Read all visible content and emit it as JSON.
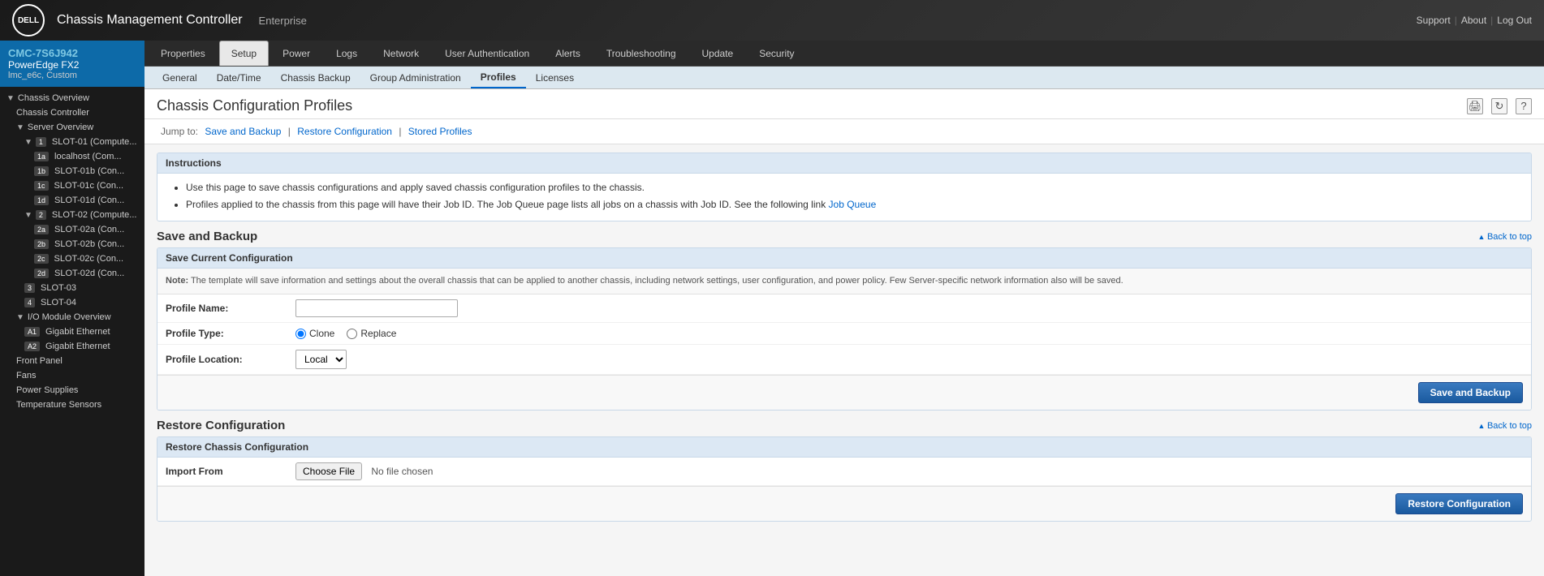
{
  "header": {
    "logo_text": "DELL",
    "title": "Chassis Management Controller",
    "edition": "Enterprise",
    "links": [
      "Support",
      "About",
      "Log Out"
    ]
  },
  "sidebar": {
    "device_id": "CMC-7S6J942",
    "device_model": "PowerEdge FX2",
    "device_info": "lmc_e6c, Custom",
    "tree": [
      {
        "id": "chassis-overview",
        "label": "Chassis Overview",
        "level": 0,
        "arrow": "▼",
        "selected": false
      },
      {
        "id": "chassis-controller",
        "label": "Chassis Controller",
        "level": 1,
        "selected": false
      },
      {
        "id": "server-overview",
        "label": "Server Overview",
        "level": 1,
        "arrow": "▼",
        "selected": false
      },
      {
        "id": "slot01",
        "label": "SLOT-01 (Compute...",
        "level": 2,
        "badge": "1",
        "arrow": "▼",
        "selected": false
      },
      {
        "id": "slot01-1a",
        "label": "localhost (Com...",
        "level": 3,
        "badge": "1a",
        "selected": false
      },
      {
        "id": "slot01-1b",
        "label": "SLOT-01b (Con...",
        "level": 3,
        "badge": "1b",
        "selected": false
      },
      {
        "id": "slot01-1c",
        "label": "SLOT-01c (Con...",
        "level": 3,
        "badge": "1c",
        "selected": false
      },
      {
        "id": "slot01-1d",
        "label": "SLOT-01d (Con...",
        "level": 3,
        "badge": "1d",
        "selected": false
      },
      {
        "id": "slot02",
        "label": "SLOT-02 (Compute...",
        "level": 2,
        "badge": "2",
        "arrow": "▼",
        "selected": false
      },
      {
        "id": "slot02-2a",
        "label": "SLOT-02a (Con...",
        "level": 3,
        "badge": "2a",
        "selected": false
      },
      {
        "id": "slot02-2b",
        "label": "SLOT-02b (Con...",
        "level": 3,
        "badge": "2b",
        "selected": false
      },
      {
        "id": "slot02-2c",
        "label": "SLOT-02c (Con...",
        "level": 3,
        "badge": "2c",
        "selected": false
      },
      {
        "id": "slot02-2d",
        "label": "SLOT-02d (Con...",
        "level": 3,
        "badge": "2d",
        "selected": false
      },
      {
        "id": "slot03",
        "label": "SLOT-03",
        "level": 2,
        "badge": "3",
        "selected": false
      },
      {
        "id": "slot04",
        "label": "SLOT-04",
        "level": 2,
        "badge": "4",
        "selected": false
      },
      {
        "id": "io-module-overview",
        "label": "I/O Module Overview",
        "level": 1,
        "arrow": "▼",
        "selected": false
      },
      {
        "id": "io-a1",
        "label": "Gigabit Ethernet",
        "level": 2,
        "badge": "A1",
        "selected": false
      },
      {
        "id": "io-a2",
        "label": "Gigabit Ethernet",
        "level": 2,
        "badge": "A2",
        "selected": false
      },
      {
        "id": "front-panel",
        "label": "Front Panel",
        "level": 1,
        "selected": false
      },
      {
        "id": "fans",
        "label": "Fans",
        "level": 1,
        "selected": false
      },
      {
        "id": "power-supplies",
        "label": "Power Supplies",
        "level": 1,
        "selected": false
      },
      {
        "id": "temperature-sensors",
        "label": "Temperature Sensors",
        "level": 1,
        "selected": false
      }
    ]
  },
  "primary_tabs": [
    {
      "id": "properties",
      "label": "Properties",
      "active": false
    },
    {
      "id": "setup",
      "label": "Setup",
      "active": true
    },
    {
      "id": "power",
      "label": "Power",
      "active": false
    },
    {
      "id": "logs",
      "label": "Logs",
      "active": false
    },
    {
      "id": "network",
      "label": "Network",
      "active": false
    },
    {
      "id": "user-auth",
      "label": "User Authentication",
      "active": false
    },
    {
      "id": "alerts",
      "label": "Alerts",
      "active": false
    },
    {
      "id": "troubleshooting",
      "label": "Troubleshooting",
      "active": false
    },
    {
      "id": "update",
      "label": "Update",
      "active": false
    },
    {
      "id": "security",
      "label": "Security",
      "active": false
    }
  ],
  "secondary_tabs": [
    {
      "id": "general",
      "label": "General",
      "active": false
    },
    {
      "id": "datetime",
      "label": "Date/Time",
      "active": false
    },
    {
      "id": "chassis-backup",
      "label": "Chassis Backup",
      "active": false
    },
    {
      "id": "group-admin",
      "label": "Group Administration",
      "active": false
    },
    {
      "id": "profiles",
      "label": "Profiles",
      "active": true
    },
    {
      "id": "licenses",
      "label": "Licenses",
      "active": false
    }
  ],
  "page": {
    "title": "Chassis Configuration Profiles",
    "jump_to_label": "Jump to:",
    "jump_links": [
      {
        "id": "save-backup-link",
        "label": "Save and Backup"
      },
      {
        "id": "restore-config-link",
        "label": "Restore Configuration"
      },
      {
        "id": "stored-profiles-link",
        "label": "Stored Profiles"
      }
    ]
  },
  "instructions": {
    "header": "Instructions",
    "bullets": [
      "Use this page to save chassis configurations and apply saved chassis configuration profiles to the chassis.",
      "Profiles applied to the chassis from this page will have their Job ID. The Job Queue page lists all jobs on a chassis with Job ID. See the following link Job Queue"
    ],
    "link_text": "Job Queue"
  },
  "save_backup": {
    "section_title": "Save and Backup",
    "back_to_top": "Back to top",
    "form_header": "Save Current Configuration",
    "note": "Note: The template will save information and settings about the overall chassis that can be applied to another chassis, including network settings, user configuration, and power policy. Few Server-specific network information also will be saved.",
    "profile_name_label": "Profile Name:",
    "profile_name_value": "",
    "profile_type_label": "Profile Type:",
    "profile_type_options": [
      {
        "id": "clone",
        "label": "Clone",
        "checked": true
      },
      {
        "id": "replace",
        "label": "Replace",
        "checked": false
      }
    ],
    "profile_location_label": "Profile Location:",
    "profile_location_options": [
      {
        "id": "local",
        "label": "Local",
        "selected": true
      }
    ],
    "save_button": "Save and Backup"
  },
  "restore_config": {
    "section_title": "Restore Configuration",
    "back_to_top": "Back to top",
    "form_header": "Restore Chassis Configuration",
    "import_from_label": "Import From",
    "choose_file_label": "Choose File",
    "no_file_chosen": "No file chosen",
    "restore_button": "Restore Configuration"
  },
  "icons": {
    "print": "🖨",
    "refresh": "↻",
    "help": "?"
  }
}
